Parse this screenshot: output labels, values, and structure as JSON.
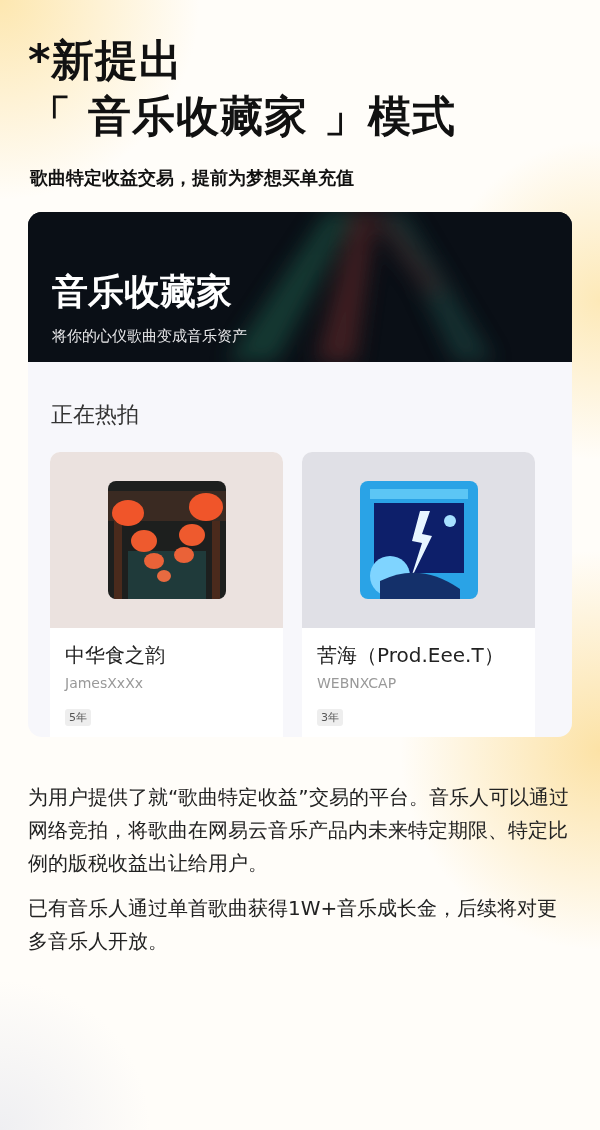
{
  "headline": [
    "*新提出",
    "「 音乐收藏家 」模式"
  ],
  "tagline": "歌曲特定收益交易，提前为梦想买单充值",
  "app_card": {
    "banner": {
      "title": "音乐收藏家",
      "subtitle": "将你的心仪歌曲变成音乐资产"
    },
    "section_title": "正在热拍",
    "items": [
      {
        "title": "中华食之韵",
        "artist": "JamesXxXx",
        "term": "5年",
        "kind": "picture"
      },
      {
        "title": "苦海（Prod.Eee.T）",
        "artist": "WEBNXCAP",
        "term": "3年",
        "kind": "picture"
      }
    ]
  },
  "paragraphs": [
    "为用户提供了就“歌曲特定收益”交易的平台。音乐人可以通过网络竞拍，将歌曲在网易云音乐产品内未来特定期限、特定比例的版税收益出让给用户。",
    "已有音乐人通过单首歌曲获得1W+音乐成长金，后续将对更多音乐人开放。"
  ]
}
